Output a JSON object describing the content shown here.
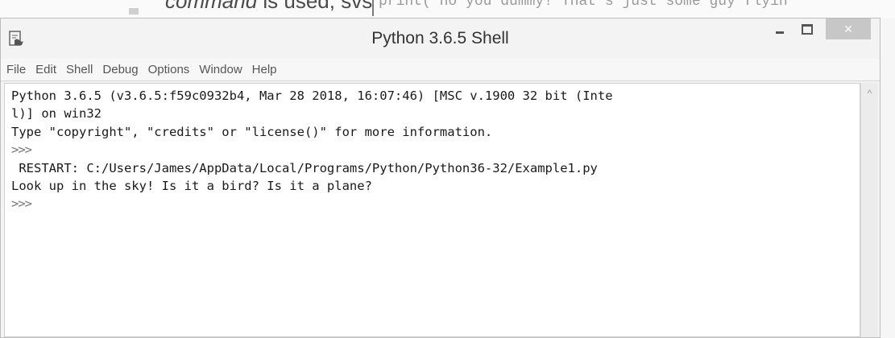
{
  "background": {
    "text_prefix_italic": "command",
    "text_suffix": " is used, svs",
    "code_fragment": "print( no you dummy! That's just some guy flyin"
  },
  "window": {
    "title": "Python 3.6.5 Shell",
    "close_glyph": "×"
  },
  "menu": [
    "File",
    "Edit",
    "Shell",
    "Debug",
    "Options",
    "Window",
    "Help"
  ],
  "shell": {
    "lines": [
      "Python 3.6.5 (v3.6.5:f59c0932b4, Mar 28 2018, 16:07:46) [MSC v.1900 32 bit (Inte",
      "l)] on win32",
      "Type \"copyright\", \"credits\" or \"license()\" for more information.",
      ">>>",
      " RESTART: C:/Users/James/AppData/Local/Programs/Python/Python36-32/Example1.py",
      "Look up in the sky! Is it a bird? Is it a plane?",
      ">>>"
    ]
  },
  "icons": {
    "app": "python-idle-icon",
    "minimize": "minimize-icon",
    "maximize": "maximize-icon",
    "close": "close-icon",
    "scroll_up": "scroll-up-arrow-icon"
  }
}
